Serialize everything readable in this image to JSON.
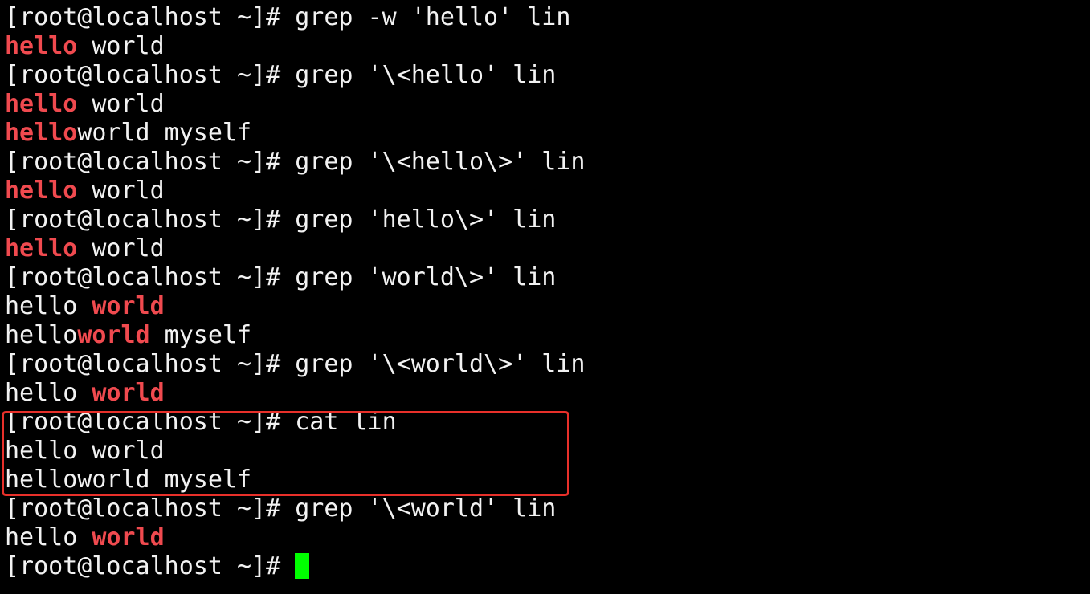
{
  "terminal": {
    "highlight_color": "#f04a4f",
    "cursor_color": "#00ff00",
    "annotation_box_color": "#e8302a",
    "lines": [
      [
        {
          "text": "[root@localhost ~]# grep -w 'hello' lin",
          "hl": false
        }
      ],
      [
        {
          "text": "hello",
          "hl": true
        },
        {
          "text": " world",
          "hl": false
        }
      ],
      [
        {
          "text": "[root@localhost ~]# grep '\\<hello' lin",
          "hl": false
        }
      ],
      [
        {
          "text": "hello",
          "hl": true
        },
        {
          "text": " world",
          "hl": false
        }
      ],
      [
        {
          "text": "hello",
          "hl": true
        },
        {
          "text": "world myself",
          "hl": false
        }
      ],
      [
        {
          "text": "[root@localhost ~]# grep '\\<hello\\>' lin",
          "hl": false
        }
      ],
      [
        {
          "text": "hello",
          "hl": true
        },
        {
          "text": " world",
          "hl": false
        }
      ],
      [
        {
          "text": "[root@localhost ~]# grep 'hello\\>' lin",
          "hl": false
        }
      ],
      [
        {
          "text": "hello",
          "hl": true
        },
        {
          "text": " world",
          "hl": false
        }
      ],
      [
        {
          "text": "[root@localhost ~]# grep 'world\\>' lin",
          "hl": false
        }
      ],
      [
        {
          "text": "hello ",
          "hl": false
        },
        {
          "text": "world",
          "hl": true
        }
      ],
      [
        {
          "text": "hello",
          "hl": false
        },
        {
          "text": "world",
          "hl": true
        },
        {
          "text": " myself",
          "hl": false
        }
      ],
      [
        {
          "text": "[root@localhost ~]# grep '\\<world\\>' lin",
          "hl": false
        }
      ],
      [
        {
          "text": "hello ",
          "hl": false
        },
        {
          "text": "world",
          "hl": true
        }
      ],
      [
        {
          "text": "[root@localhost ~]# cat lin",
          "hl": false
        }
      ],
      [
        {
          "text": "hello world",
          "hl": false
        }
      ],
      [
        {
          "text": "helloworld myself",
          "hl": false
        }
      ],
      [
        {
          "text": "[root@localhost ~]# grep '\\<world' lin",
          "hl": false
        }
      ],
      [
        {
          "text": "hello ",
          "hl": false
        },
        {
          "text": "world",
          "hl": true
        }
      ],
      [
        {
          "text": "[root@localhost ~]# ",
          "hl": false
        }
      ]
    ]
  }
}
